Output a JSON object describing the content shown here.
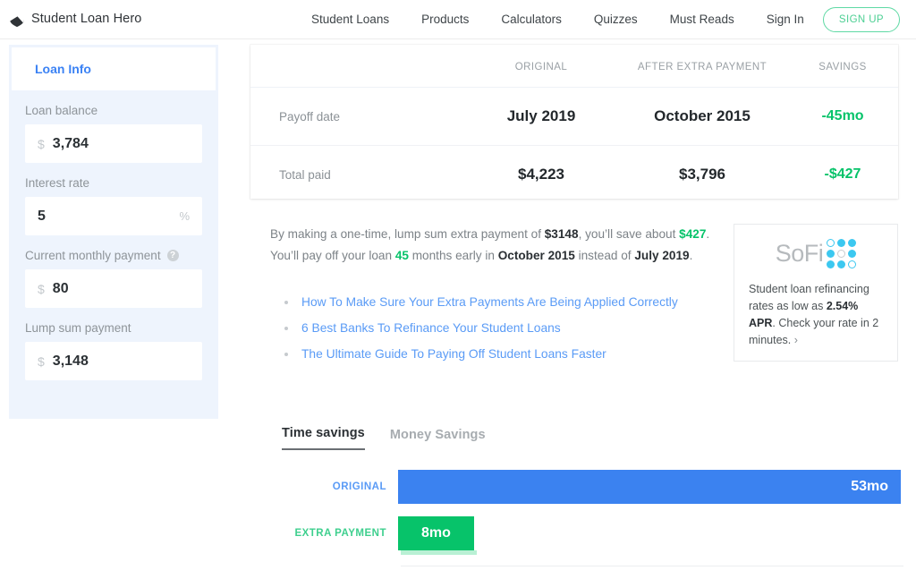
{
  "brand": {
    "name": "Student Loan Hero",
    "logo_icon": "shield-icon"
  },
  "nav": {
    "links": [
      "Student Loans",
      "Products",
      "Calculators",
      "Quizzes",
      "Must Reads",
      "Sign In"
    ],
    "signup_label": "SIGN UP"
  },
  "sidebar": {
    "tab_label": "Loan Info",
    "fields": [
      {
        "label": "Loan balance",
        "prefix": "$",
        "value": "3,784",
        "suffix": "",
        "help": false
      },
      {
        "label": "Interest rate",
        "prefix": "",
        "value": "5",
        "suffix": "%",
        "help": false
      },
      {
        "label": "Current monthly payment",
        "prefix": "$",
        "value": "80",
        "suffix": "",
        "help": true
      },
      {
        "label": "Lump sum payment",
        "prefix": "$",
        "value": "3,148",
        "suffix": "",
        "help": false
      }
    ]
  },
  "results": {
    "headers": [
      "",
      "ORIGINAL",
      "AFTER EXTRA PAYMENT",
      "SAVINGS"
    ],
    "rows": [
      {
        "label": "Payoff date",
        "original": "July 2019",
        "after": "October 2015",
        "savings": "-45mo"
      },
      {
        "label": "Total paid",
        "original": "$4,223",
        "after": "$3,796",
        "savings": "-$427"
      }
    ]
  },
  "summary": {
    "p1": "By making a one-time, lump sum extra payment of ",
    "lump_sum": "$3148",
    "p2": ", you’ll save about ",
    "savings": "$427",
    "p3": ". You’ll pay off your loan ",
    "months": "45",
    "p4": " months early in ",
    "new_date": "October 2015",
    "p5": " instead of ",
    "old_date": "July 2019",
    "p6": "."
  },
  "links": [
    "How To Make Sure Your Extra Payments Are Being Applied Correctly",
    "6 Best Banks To Refinance Your Student Loans",
    "The Ultimate Guide To Paying Off Student Loans Faster"
  ],
  "ad": {
    "logo_text": "SoFi",
    "body_1": "Student loan refinancing rates as low as ",
    "rate": "2.54% APR",
    "body_2": ". Check your rate in 2 minutes. ",
    "chevron": "›"
  },
  "chart_tabs": {
    "active": "Time savings",
    "inactive": "Money Savings"
  },
  "chart_data": {
    "type": "bar",
    "title": "Time savings",
    "orientation": "horizontal",
    "categories": [
      "ORIGINAL",
      "EXTRA PAYMENT"
    ],
    "values": [
      53,
      8
    ],
    "labels": [
      "53mo",
      "8mo"
    ],
    "unit": "months",
    "colors": [
      "#3b82f0",
      "#07c36a"
    ],
    "xlabel": "",
    "ylabel": "",
    "xlim": [
      0,
      53
    ],
    "grid": false,
    "legend": false
  },
  "colors": {
    "accent_blue": "#3b82f0",
    "accent_green": "#07c36a",
    "sidebar_bg": "#eef4fd",
    "signup_border": "#5fd9a4"
  }
}
